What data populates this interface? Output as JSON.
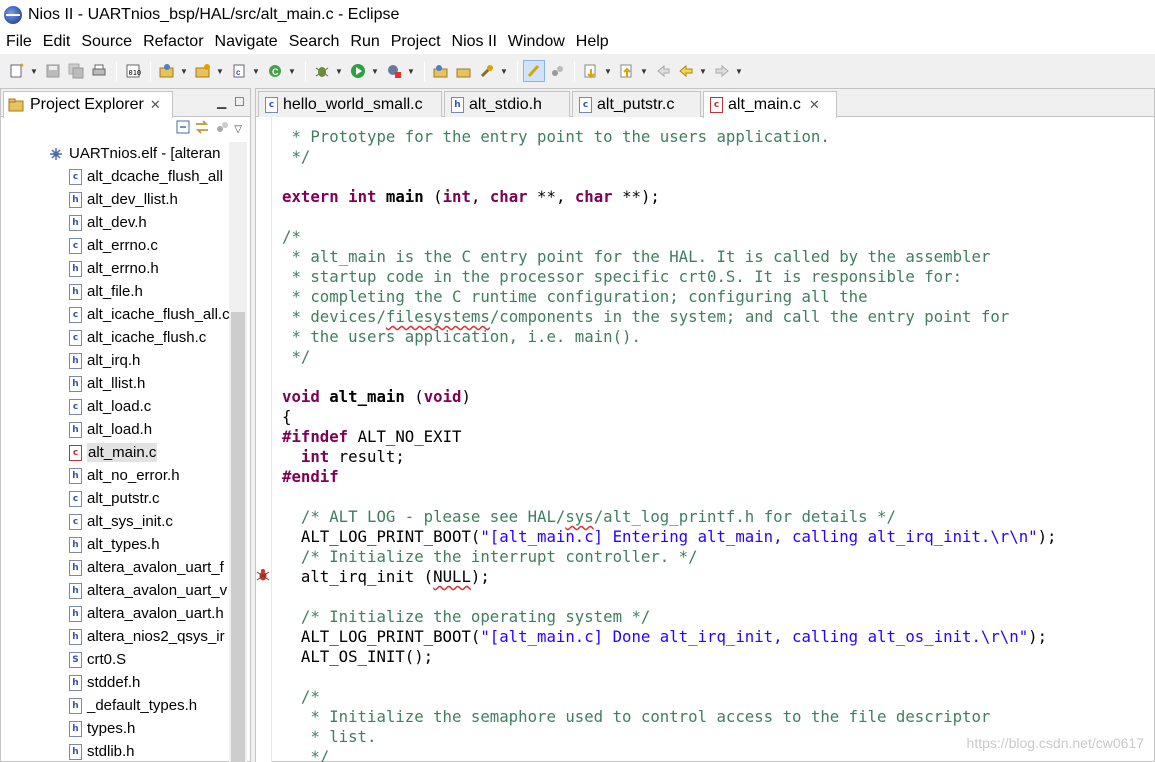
{
  "window": {
    "title": "Nios II - UARTnios_bsp/HAL/src/alt_main.c - Eclipse"
  },
  "menu": [
    "File",
    "Edit",
    "Source",
    "Refactor",
    "Navigate",
    "Search",
    "Run",
    "Project",
    "Nios II",
    "Window",
    "Help"
  ],
  "explorer": {
    "tab_label": "Project Explorer",
    "root": "UARTnios.elf - [alteran",
    "items": [
      {
        "label": "alt_dcache_flush_all",
        "kind": "c"
      },
      {
        "label": "alt_dev_llist.h",
        "kind": "h"
      },
      {
        "label": "alt_dev.h",
        "kind": "h"
      },
      {
        "label": "alt_errno.c",
        "kind": "c"
      },
      {
        "label": "alt_errno.h",
        "kind": "h"
      },
      {
        "label": "alt_file.h",
        "kind": "h"
      },
      {
        "label": "alt_icache_flush_all.c",
        "kind": "c"
      },
      {
        "label": "alt_icache_flush.c",
        "kind": "c"
      },
      {
        "label": "alt_irq.h",
        "kind": "h"
      },
      {
        "label": "alt_llist.h",
        "kind": "h"
      },
      {
        "label": "alt_load.c",
        "kind": "c"
      },
      {
        "label": "alt_load.h",
        "kind": "h"
      },
      {
        "label": "alt_main.c",
        "kind": "c",
        "selected": true
      },
      {
        "label": "alt_no_error.h",
        "kind": "h"
      },
      {
        "label": "alt_putstr.c",
        "kind": "c"
      },
      {
        "label": "alt_sys_init.c",
        "kind": "c"
      },
      {
        "label": "alt_types.h",
        "kind": "h"
      },
      {
        "label": "altera_avalon_uart_f",
        "kind": "h"
      },
      {
        "label": "altera_avalon_uart_v",
        "kind": "h"
      },
      {
        "label": "altera_avalon_uart.h",
        "kind": "h"
      },
      {
        "label": "altera_nios2_qsys_ir",
        "kind": "h"
      },
      {
        "label": "crt0.S",
        "kind": "S"
      },
      {
        "label": "stddef.h",
        "kind": "h"
      },
      {
        "label": "_default_types.h",
        "kind": "h"
      },
      {
        "label": "types.h",
        "kind": "h"
      },
      {
        "label": "stdlib.h",
        "kind": "h"
      }
    ]
  },
  "editor": {
    "tabs": [
      {
        "label": "hello_world_small.c",
        "kind": "c"
      },
      {
        "label": "alt_stdio.h",
        "kind": "h"
      },
      {
        "label": "alt_putstr.c",
        "kind": "c"
      },
      {
        "label": "alt_main.c",
        "kind": "c",
        "active": true
      }
    ],
    "code_lines": [
      [
        [
          "cm",
          " * Prototype for the entry point to the users application."
        ]
      ],
      [
        [
          "cm",
          " */"
        ]
      ],
      [],
      [
        [
          "kw",
          "extern"
        ],
        [
          "",
          " "
        ],
        [
          "kw",
          "int"
        ],
        [
          "",
          " "
        ],
        [
          "fn",
          "main"
        ],
        [
          "",
          " ("
        ],
        [
          "kw",
          "int"
        ],
        [
          "",
          ", "
        ],
        [
          "kw",
          "char"
        ],
        [
          "",
          " **, "
        ],
        [
          "kw",
          "char"
        ],
        [
          "",
          " **);"
        ]
      ],
      [],
      [
        [
          "cm",
          "/*"
        ]
      ],
      [
        [
          "cm",
          " * alt_main is the C entry point for the HAL. It is called by the assembler"
        ]
      ],
      [
        [
          "cm",
          " * startup code in the processor specific crt0.S. It is responsible for:"
        ]
      ],
      [
        [
          "cm",
          " * completing the C runtime configuration; configuring all the"
        ]
      ],
      [
        [
          "cm",
          " * devices/"
        ],
        [
          "cm squig",
          "filesystems"
        ],
        [
          "cm",
          "/components in the system; and call the entry point for"
        ]
      ],
      [
        [
          "cm",
          " * the users application, i.e. main()."
        ]
      ],
      [
        [
          "cm",
          " */"
        ]
      ],
      [],
      [
        [
          "kw",
          "void"
        ],
        [
          "",
          " "
        ],
        [
          "fn",
          "alt_main"
        ],
        [
          "",
          " ("
        ],
        [
          "kw",
          "void"
        ],
        [
          "",
          ")"
        ]
      ],
      [
        [
          "",
          "{"
        ]
      ],
      [
        [
          "pp",
          "#ifndef"
        ],
        [
          "",
          " ALT_NO_EXIT"
        ]
      ],
      [
        [
          "",
          "  "
        ],
        [
          "kw",
          "int"
        ],
        [
          "",
          " result;"
        ]
      ],
      [
        [
          "pp",
          "#endif"
        ]
      ],
      [],
      [
        [
          "",
          "  "
        ],
        [
          "cm",
          "/* ALT LOG - please see HAL/"
        ],
        [
          "cm squig",
          "sys"
        ],
        [
          "cm",
          "/alt_log_printf.h for details */"
        ]
      ],
      [
        [
          "",
          "  ALT_LOG_PRINT_BOOT("
        ],
        [
          "st",
          "\"[alt_main.c] Entering alt_main, calling alt_irq_init.\\r\\n\""
        ],
        [
          "",
          ");"
        ]
      ],
      [
        [
          "",
          "  "
        ],
        [
          "cm",
          "/* Initialize the interrupt controller. */"
        ]
      ],
      [
        [
          "",
          "  alt_irq_init ("
        ],
        [
          "squig",
          "NULL"
        ],
        [
          "",
          ");"
        ]
      ],
      [],
      [
        [
          "",
          "  "
        ],
        [
          "cm",
          "/* Initialize the operating system */"
        ]
      ],
      [
        [
          "",
          "  ALT_LOG_PRINT_BOOT("
        ],
        [
          "st",
          "\"[alt_main.c] Done alt_irq_init, calling alt_os_init.\\r\\n\""
        ],
        [
          "",
          ");"
        ]
      ],
      [
        [
          "",
          "  ALT_OS_INIT();"
        ]
      ],
      [],
      [
        [
          "",
          "  "
        ],
        [
          "cm",
          "/*"
        ]
      ],
      [
        [
          "",
          "  "
        ],
        [
          "cm",
          " * Initialize the semaphore used to control access to the file descriptor"
        ]
      ],
      [
        [
          "",
          "  "
        ],
        [
          "cm",
          " * list."
        ]
      ],
      [
        [
          "",
          "  "
        ],
        [
          "cm",
          " */"
        ]
      ]
    ]
  },
  "watermark": "https://blog.csdn.net/cw0617",
  "colors": {
    "comment": "#3f7f5f",
    "keyword": "#7f0055",
    "string": "#2a00ff"
  }
}
